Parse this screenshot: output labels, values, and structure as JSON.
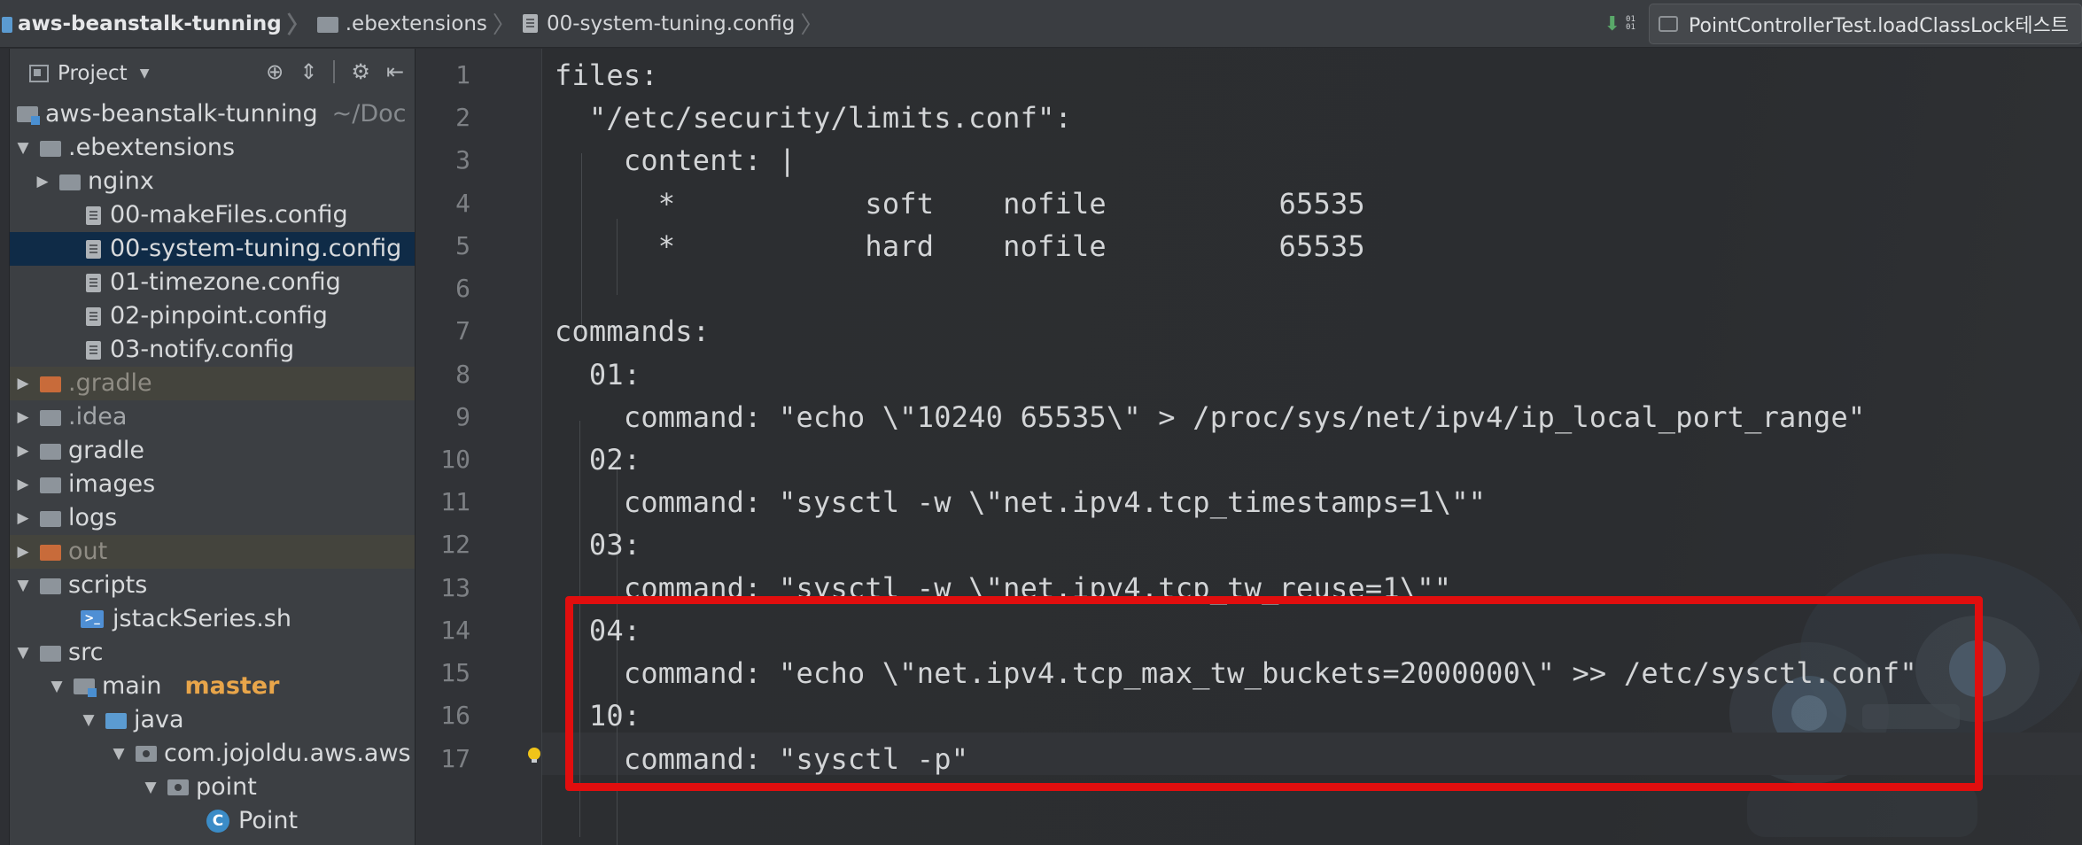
{
  "navbar": {
    "crumbs": [
      "aws-beanstalk-tunning",
      ".ebextensions",
      "00-system-tuning.config"
    ],
    "run_bits": "0101",
    "run_config": "PointControllerTest.loadClassLock테스트"
  },
  "project_panel": {
    "title": "Project",
    "rows": [
      {
        "label": "aws-beanstalk-tunning",
        "sub": "~/Doc"
      },
      {
        "label": ".ebextensions"
      },
      {
        "label": "nginx"
      },
      {
        "label": "00-makeFiles.config"
      },
      {
        "label": "00-system-tuning.config"
      },
      {
        "label": "01-timezone.config"
      },
      {
        "label": "02-pinpoint.config"
      },
      {
        "label": "03-notify.config"
      },
      {
        "label": ".gradle"
      },
      {
        "label": ".idea"
      },
      {
        "label": "gradle"
      },
      {
        "label": "images"
      },
      {
        "label": "logs"
      },
      {
        "label": "out"
      },
      {
        "label": "scripts"
      },
      {
        "label": "jstackSeries.sh"
      },
      {
        "label": "src"
      },
      {
        "label": "main",
        "branch": "master"
      },
      {
        "label": "java"
      },
      {
        "label": "com.jojoldu.aws.aws"
      },
      {
        "label": "point"
      },
      {
        "label": "Point"
      }
    ]
  },
  "editor": {
    "line_numbers": [
      "1",
      "2",
      "3",
      "4",
      "5",
      "6",
      "7",
      "8",
      "9",
      "10",
      "11",
      "12",
      "13",
      "14",
      "15",
      "16",
      "17"
    ],
    "lines": [
      "files:",
      "  \"/etc/security/limits.conf\":",
      "    content: |",
      "      *           soft    nofile          65535",
      "      *           hard    nofile          65535",
      "",
      "commands:",
      "  01:",
      "    command: \"echo \\\"10240 65535\\\" > /proc/sys/net/ipv4/ip_local_port_range\"",
      "  02:",
      "    command: \"sysctl -w \\\"net.ipv4.tcp_timestamps=1\\\"\"",
      "  03:",
      "    command: \"sysctl -w \\\"net.ipv4.tcp_tw_reuse=1\\\"\"",
      "  04:",
      "    command: \"echo \\\"net.ipv4.tcp_max_tw_buckets=2000000\\\" >> /etc/sysctl.conf\"",
      "  10:",
      "    command: \"sysctl -p\""
    ]
  },
  "colors": {
    "highlight_box": "#e10e0e",
    "selection": "#0f2b47",
    "branch": "#e8a54a"
  }
}
